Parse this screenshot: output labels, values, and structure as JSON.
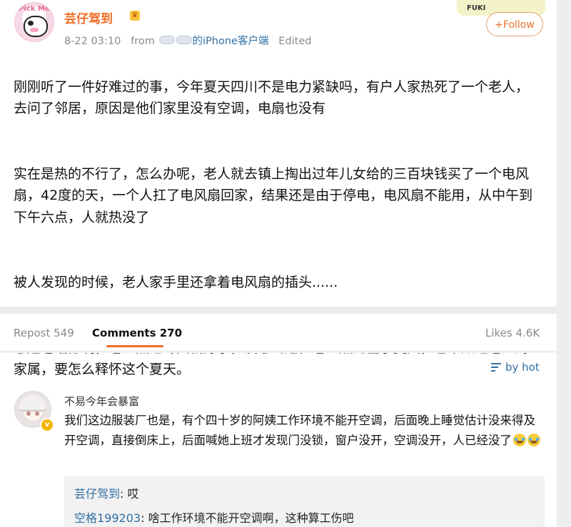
{
  "post": {
    "username": "芸仔驾到",
    "time": "8-22 03:10",
    "from_label": "from",
    "source": "的iPhone客户端",
    "edited": "Edited",
    "badge_text": "FUKI",
    "follow_label": "+Follow",
    "paragraphs": [
      "刚刚听了一件好难过的事，今年夏天四川不是电力紧缺吗，有户人家热死了一个老人，去问了邻居，原因是他们家里没有空调，电扇也没有",
      "实在是热的不行了，怎么办呢，老人就去镇上掏出过年儿女给的三百块钱买了一个电风扇，42度的天，一个人扛了电风扇回家，结果还是由于停电，电风扇不能用，从中午到下午六点，人就热没了",
      "被人发现的时候，老人家手里还拿着电风扇的插头......",
      "想起老话都说，老人熬过冬天就好了，没想到这位老人热死在了夏天，也不知道老人的家属，要怎么释怀这个夏天。"
    ]
  },
  "tabs": {
    "repost": "Repost 549",
    "comments": "Comments 270",
    "likes": "Likes 4.6K"
  },
  "sort": {
    "label": "by hot"
  },
  "comment": {
    "username": "不易今年会暴富",
    "text": "我们这边服装厂也是，有个四十岁的阿姨工作环境不能开空调，后面晚上睡觉估计没来得及开空调，直接倒床上，后面喊她上班才发现门没锁，窗户没开，空调没开，人已经没了",
    "replies": [
      {
        "name": "芸仔驾到",
        "text": "哎"
      },
      {
        "name": "空格199203",
        "text": "啥工作环境不能开空调啊，这种算工伤吧"
      }
    ]
  },
  "colors": {
    "accent_orange": "#f06c25",
    "link_blue": "#2f6fa4",
    "separator_gray": "#ececec"
  }
}
